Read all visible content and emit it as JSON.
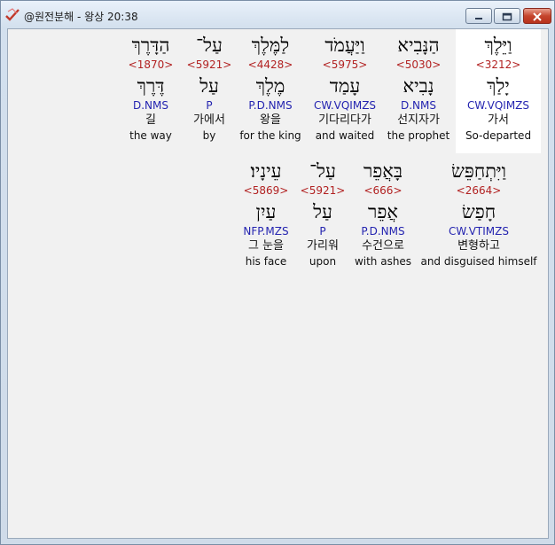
{
  "window": {
    "title": "@원전분해 - 왕상 20:38",
    "icon": "app-check-icon"
  },
  "controls": {
    "minimize_icon": "minimize-icon",
    "maximize_icon": "maximize-icon",
    "close_icon": "close-icon"
  },
  "rows": [
    {
      "words": [
        {
          "hebrew": "וַיֵּלֶךְ",
          "strong": "<3212>",
          "lemma": "יָלַךְ",
          "morph": "CW.VQIMZS",
          "korean": "가서",
          "english": "So-departed",
          "selected": true
        },
        {
          "hebrew": "הַנָּבִיא",
          "strong": "<5030>",
          "lemma": "נָבִיא",
          "morph": "D.NMS",
          "korean": "선지자가",
          "english": "the prophet",
          "selected": false
        },
        {
          "hebrew": "וַיַּעֲמֹד",
          "strong": "<5975>",
          "lemma": "עָמַד",
          "morph": "CW.VQIMZS",
          "korean": "기다리다가",
          "english": "and waited",
          "selected": false
        },
        {
          "hebrew": "לַמֶּלֶךְ",
          "strong": "<4428>",
          "lemma": "מֶלֶךְ",
          "morph": "P.D.NMS",
          "korean": "왕을",
          "english": "for the king",
          "selected": false
        },
        {
          "hebrew": "עַל־",
          "strong": "<5921>",
          "lemma": "עַל",
          "morph": "P",
          "korean": "가에서",
          "english": "by",
          "selected": false
        },
        {
          "hebrew": "הַדָּרֶךְ",
          "strong": "<1870>",
          "lemma": "דֶּרֶךְ",
          "morph": "D.NMS",
          "korean": "길",
          "english": "the way",
          "selected": false
        }
      ]
    },
    {
      "words": [
        {
          "hebrew": "וַיִּתְחַפֵּשׂ",
          "strong": "<2664>",
          "lemma": "חָפַשׂ",
          "morph": "CW.VTIMZS",
          "korean": "변형하고",
          "english": "and disguised himself",
          "selected": false
        },
        {
          "hebrew": "בָּאֲפֵר",
          "strong": "<666>",
          "lemma": "אֲפֵר",
          "morph": "P.D.NMS",
          "korean": "수건으로",
          "english": "with ashes",
          "selected": false
        },
        {
          "hebrew": "עַל־",
          "strong": "<5921>",
          "lemma": "עַל",
          "morph": "P",
          "korean": "가리워",
          "english": "upon",
          "selected": false
        },
        {
          "hebrew": "עֵינָיו׃",
          "strong": "<5869>",
          "lemma": "עַיִן",
          "morph": "NFP.MZS",
          "korean": "그 눈을",
          "english": "his face",
          "selected": false
        }
      ]
    }
  ],
  "colors": {
    "strong": "#b22222",
    "morph": "#2424b0",
    "selected_bg": "#ffffff"
  }
}
